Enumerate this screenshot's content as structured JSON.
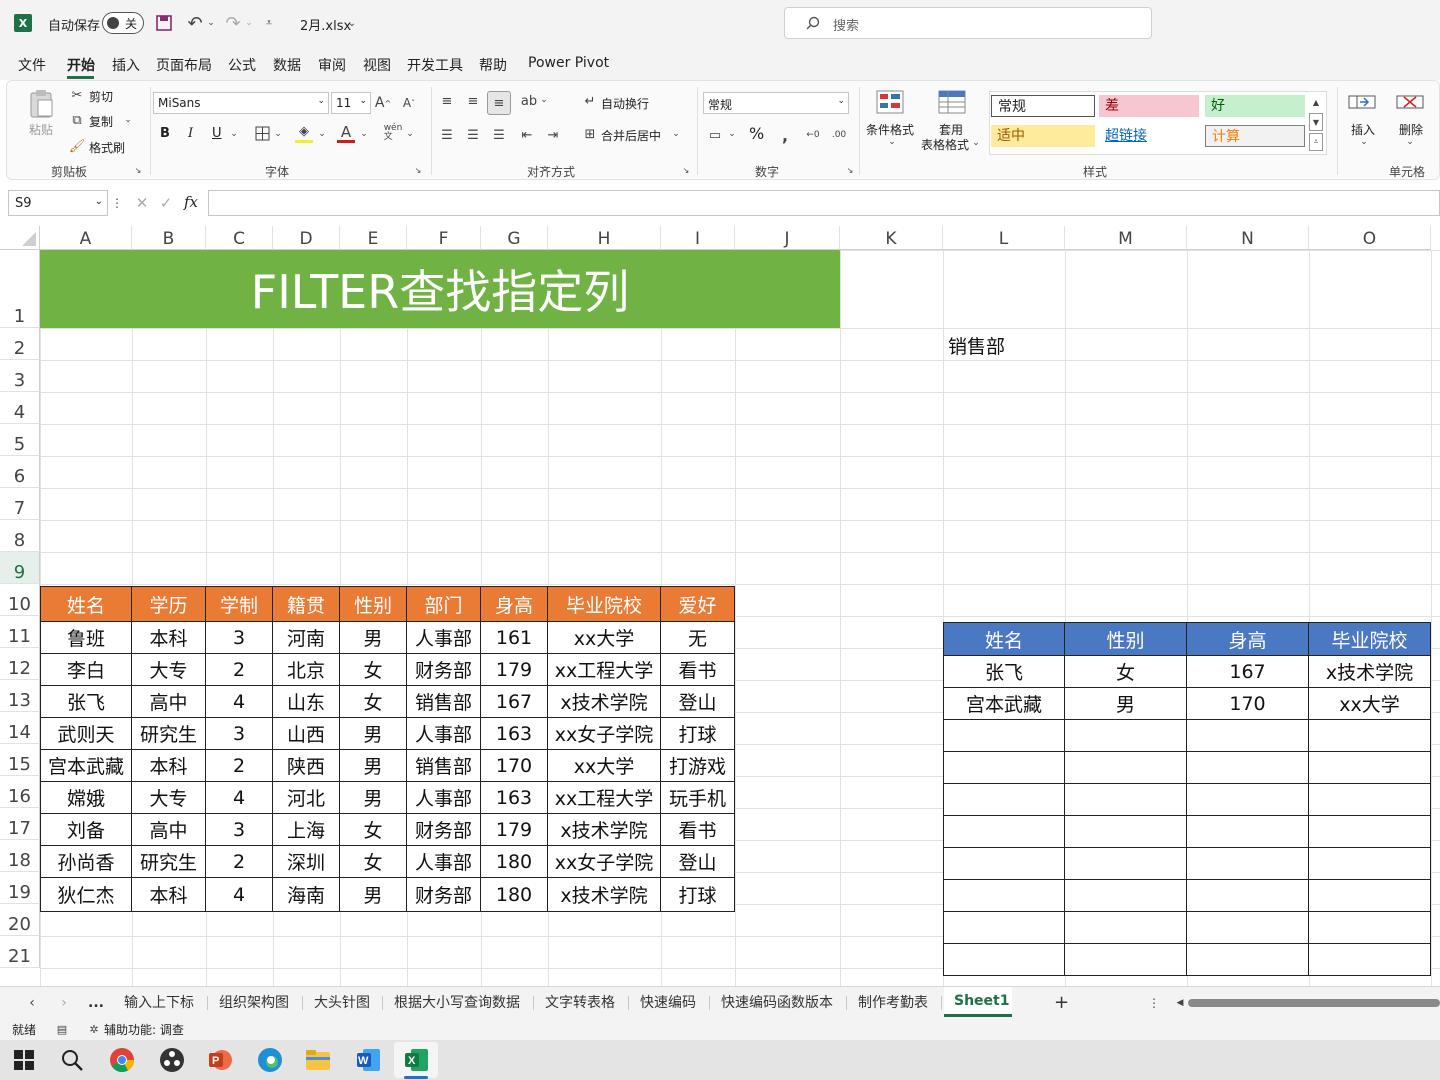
{
  "titlebar": {
    "autosave_label": "自动保存",
    "autosave_state": "关",
    "filename": "2月.xlsx",
    "search_placeholder": "搜索"
  },
  "menu": {
    "tabs": [
      "文件",
      "开始",
      "插入",
      "页面布局",
      "公式",
      "数据",
      "审阅",
      "视图",
      "开发工具",
      "帮助",
      "Power Pivot"
    ],
    "active": "开始"
  },
  "ribbon": {
    "clipboard": {
      "paste": "粘贴",
      "cut": "剪切",
      "copy": "复制",
      "format_painter": "格式刷",
      "group": "剪贴板"
    },
    "font": {
      "name": "MiSans",
      "size": "11",
      "bold": "B",
      "italic": "I",
      "underline": "U",
      "group": "字体"
    },
    "alignment": {
      "wrap": "自动换行",
      "merge": "合并后居中",
      "group": "对齐方式"
    },
    "number": {
      "format": "常规",
      "percent": "%",
      "group": "数字"
    },
    "styles": {
      "conditional": "条件格式",
      "table_line1": "套用",
      "table_line2": "表格格式",
      "normal": "常规",
      "bad": "差",
      "good": "好",
      "neutral": "适中",
      "hyperlink": "超链接",
      "calc": "计算",
      "group": "样式"
    },
    "cells": {
      "insert": "插入",
      "delete": "删除",
      "group": "单元格"
    }
  },
  "formula_bar": {
    "name_box": "S9",
    "fx": "fx",
    "formula": ""
  },
  "columns": [
    "A",
    "B",
    "C",
    "D",
    "E",
    "F",
    "G",
    "H",
    "I",
    "J",
    "K",
    "L",
    "M",
    "N",
    "O"
  ],
  "rows": [
    "1",
    "2",
    "3",
    "4",
    "5",
    "6",
    "7",
    "8",
    "9",
    "10",
    "11",
    "12",
    "13",
    "14",
    "15",
    "16",
    "17",
    "18",
    "19",
    "20",
    "21"
  ],
  "sheet": {
    "title": "FILTER查找指定列",
    "lookup_value": "销售部",
    "main_headers": [
      "姓名",
      "学历",
      "学制",
      "籍贯",
      "性别",
      "部门",
      "身高",
      "毕业院校",
      "爱好"
    ],
    "main_rows": [
      [
        "鲁班",
        "本科",
        "3",
        "河南",
        "男",
        "人事部",
        "161",
        "xx大学",
        "无"
      ],
      [
        "李白",
        "大专",
        "2",
        "北京",
        "女",
        "财务部",
        "179",
        "xx工程大学",
        "看书"
      ],
      [
        "张飞",
        "高中",
        "4",
        "山东",
        "女",
        "销售部",
        "167",
        "x技术学院",
        "登山"
      ],
      [
        "武则天",
        "研究生",
        "3",
        "山西",
        "男",
        "人事部",
        "163",
        "xx女子学院",
        "打球"
      ],
      [
        "宫本武藏",
        "本科",
        "2",
        "陕西",
        "男",
        "销售部",
        "170",
        "xx大学",
        "打游戏"
      ],
      [
        "嫦娥",
        "大专",
        "4",
        "河北",
        "男",
        "人事部",
        "163",
        "xx工程大学",
        "玩手机"
      ],
      [
        "刘备",
        "高中",
        "3",
        "上海",
        "女",
        "财务部",
        "179",
        "x技术学院",
        "看书"
      ],
      [
        "孙尚香",
        "研究生",
        "2",
        "深圳",
        "女",
        "人事部",
        "180",
        "xx女子学院",
        "登山"
      ],
      [
        "狄仁杰",
        "本科",
        "4",
        "海南",
        "男",
        "财务部",
        "180",
        "x技术学院",
        "打球"
      ]
    ],
    "result_headers": [
      "姓名",
      "性别",
      "身高",
      "毕业院校"
    ],
    "result_rows": [
      [
        "张飞",
        "女",
        "167",
        "x技术学院"
      ],
      [
        "宫本武藏",
        "男",
        "170",
        "xx大学"
      ],
      [
        "",
        "",
        "",
        ""
      ],
      [
        "",
        "",
        "",
        ""
      ],
      [
        "",
        "",
        "",
        ""
      ],
      [
        "",
        "",
        "",
        ""
      ],
      [
        "",
        "",
        "",
        ""
      ],
      [
        "",
        "",
        "",
        ""
      ],
      [
        "",
        "",
        "",
        ""
      ],
      [
        "",
        "",
        "",
        ""
      ]
    ]
  },
  "sheet_tabs": [
    "输入上下标",
    "组织架构图",
    "大头针图",
    "根据大小写查询数据",
    "文字转表格",
    "快速编码",
    "快速编码函数版本",
    "制作考勤表",
    "Sheet1"
  ],
  "active_sheet": "Sheet1",
  "ellipsis": "...",
  "plus": "+",
  "status": {
    "ready": "就绪",
    "accessibility": "辅助功能: 调查"
  },
  "colors": {
    "title_bg": "#70B244",
    "main_header": "#E97B35",
    "result_header": "#4A78C2",
    "excel_green": "#1E7145"
  }
}
